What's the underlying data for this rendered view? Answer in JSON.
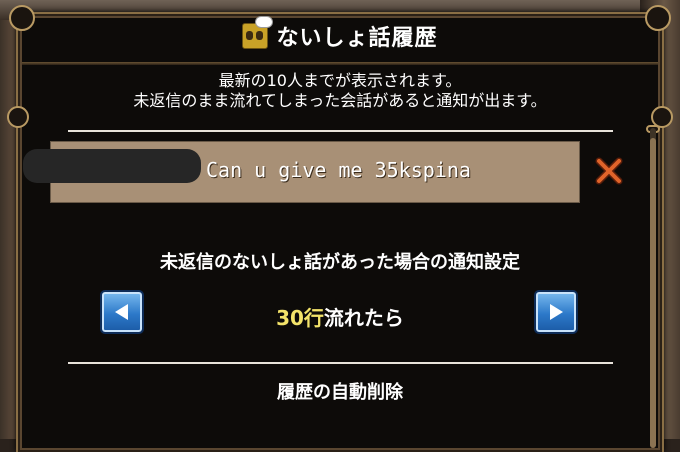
{
  "dialog": {
    "title": "ないしょ話履歴",
    "title_icon": "whisper-chat-icon"
  },
  "description": {
    "line1": "最新の10人までが表示されます。",
    "line2": "未返信のまま流れてしまった会話があると通知が出ます。"
  },
  "whispers": [
    {
      "sender": "",
      "message": "Can u give me 35kspina",
      "delete_icon": "close-icon"
    }
  ],
  "notification": {
    "title": "未返信のないしょ話があった場合の通知設定",
    "value_number": "30行",
    "value_suffix": "流れたら",
    "prev_icon": "triangle-left-icon",
    "next_icon": "triangle-right-icon"
  },
  "history": {
    "auto_delete_label": "履歴の自動削除"
  },
  "colors": {
    "panel": "#0d0b09",
    "border": "#8a6f45",
    "row": "#a89076",
    "highlight_number": "#f4e46a",
    "delete_x": "#e0642a",
    "button_blue": "#2d79c9"
  }
}
